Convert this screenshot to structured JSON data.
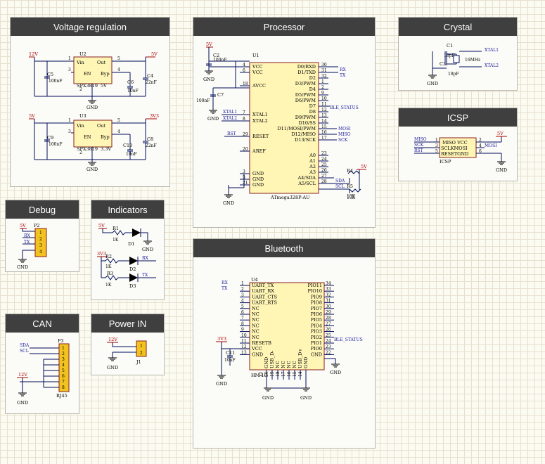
{
  "panels": {
    "voltage": "Voltage regulation",
    "processor": "Processor",
    "crystal": "Crystal",
    "icsp": "ICSP",
    "debug": "Debug",
    "indicators": "Indicators",
    "can": "CAN",
    "power": "Power IN",
    "bluetooth": "Bluetooth"
  },
  "labels": {
    "v12": "12V",
    "v5": "5V",
    "v3v3": "3V3",
    "gnd": "GND",
    "vin": "Vin",
    "out": "Out",
    "en": "EN",
    "byp": "Byp",
    "u2": "U2",
    "u3": "U3",
    "reg_part": "SPX3819",
    "reg_5v": "5V",
    "reg_3v3": "3.3V",
    "c5": "C5",
    "c6": "C6",
    "c4": "C4",
    "c9": "C9",
    "c10": "C10",
    "c8": "C8",
    "c2": "C2",
    "c7": "C7",
    "c11": "C11",
    "c1": "C1",
    "c3": "C3",
    "cap100nf": "100nF",
    "cap10nf": "10nF",
    "cap22nf": "22nF",
    "cap18pf": "18pF",
    "cap10uf": "10uF",
    "u1": "U1",
    "atmega": "ATmega328P-AU",
    "xtal1": "XTAL1",
    "xtal2": "XTAL2",
    "rst": "RST",
    "mosi": "MOSI",
    "miso": "MISO",
    "sck": "SCK",
    "rx": "RX",
    "tx": "TX",
    "ble_status": "BLE_STATUS",
    "sda": "SDA",
    "scl": "SCL",
    "r4": "R4",
    "r5": "R5",
    "r10k": "10K",
    "r1": "R1",
    "r2": "R2",
    "r3": "R3",
    "r1k": "1K",
    "d1": "D1",
    "d2": "D2",
    "d3": "D3",
    "freq": "16MHz",
    "icsp_ref": "ICSP",
    "misovcc": "MISO VCC",
    "sckmosi": "SCLKMOSI",
    "resetgnd": "RESETGND",
    "p2": "P2",
    "p3": "P3",
    "j1": "J1",
    "rj45": "RJ45",
    "u4": "U4",
    "hm10": "HM-10"
  },
  "atmega_left": [
    {
      "n": "4",
      "name": "VCC"
    },
    {
      "n": "6",
      "name": "VCC"
    },
    {
      "n": "18",
      "name": "AVCC"
    },
    {
      "n": "7",
      "name": "XTAL1"
    },
    {
      "n": "8",
      "name": "XTAL2"
    },
    {
      "n": "29",
      "name": "RESET"
    },
    {
      "n": "20",
      "name": "AREF"
    },
    {
      "n": "3",
      "name": "GND"
    },
    {
      "n": "5",
      "name": "GND"
    },
    {
      "n": "21",
      "name": "GND"
    }
  ],
  "atmega_right": [
    {
      "n": "30",
      "name": "D0/RXD"
    },
    {
      "n": "31",
      "name": "D1/TXD"
    },
    {
      "n": "32",
      "name": "D2"
    },
    {
      "n": "1",
      "name": "D3/PWM"
    },
    {
      "n": "2",
      "name": "D4"
    },
    {
      "n": "9",
      "name": "D5/PWM"
    },
    {
      "n": "10",
      "name": "D6/PWM"
    },
    {
      "n": "11",
      "name": "D7"
    },
    {
      "n": "12",
      "name": "D8"
    },
    {
      "n": "13",
      "name": "D9/PWM"
    },
    {
      "n": "14",
      "name": "D10/SS"
    },
    {
      "n": "15",
      "name": "D11/MOSI/PWM"
    },
    {
      "n": "16",
      "name": "D12/MISO"
    },
    {
      "n": "17",
      "name": "D13/SCK"
    },
    {
      "n": "23",
      "name": "A0"
    },
    {
      "n": "24",
      "name": "A1"
    },
    {
      "n": "25",
      "name": "A2"
    },
    {
      "n": "26",
      "name": "A3"
    },
    {
      "n": "27",
      "name": "A4/SDA"
    },
    {
      "n": "28",
      "name": "A5/SCL"
    }
  ],
  "hm10_left": [
    {
      "n": "1",
      "name": "UART_TX"
    },
    {
      "n": "2",
      "name": "UART_RX"
    },
    {
      "n": "3",
      "name": "UART_CTS"
    },
    {
      "n": "4",
      "name": "UART_RTS"
    },
    {
      "n": "5",
      "name": "NC"
    },
    {
      "n": "6",
      "name": "NC"
    },
    {
      "n": "7",
      "name": "NC"
    },
    {
      "n": "8",
      "name": "NC"
    },
    {
      "n": "9",
      "name": "NC"
    },
    {
      "n": "10",
      "name": "NC"
    },
    {
      "n": "11",
      "name": "RESETB"
    },
    {
      "n": "12",
      "name": "VCC"
    },
    {
      "n": "13",
      "name": "GND"
    }
  ],
  "hm10_right": [
    {
      "n": "34",
      "name": "PIO11"
    },
    {
      "n": "33",
      "name": "PIO10"
    },
    {
      "n": "32",
      "name": "PIO9"
    },
    {
      "n": "31",
      "name": "PIO8"
    },
    {
      "n": "30",
      "name": "PIO7"
    },
    {
      "n": "29",
      "name": "PIO6"
    },
    {
      "n": "28",
      "name": "PIO5"
    },
    {
      "n": "27",
      "name": "PIO4"
    },
    {
      "n": "26",
      "name": "PIO3"
    },
    {
      "n": "25",
      "name": "PIO2"
    },
    {
      "n": "24",
      "name": "PIO1"
    },
    {
      "n": "23",
      "name": "PIO0"
    },
    {
      "n": "22",
      "name": "GND"
    }
  ],
  "hm10_bottom": [
    "GND",
    "USB_D-",
    "NC",
    "NC",
    "NC",
    "NC",
    "USB_D+",
    "GND"
  ],
  "hm10_bottom_pins": [
    "21",
    "20",
    "19",
    "18",
    "17",
    "16",
    "15",
    "14"
  ],
  "icsp_pins": [
    "1",
    "3",
    "5",
    "2",
    "4",
    "6"
  ],
  "debug_pins": [
    "1",
    "2",
    "3",
    "4"
  ],
  "can_pins": [
    "1",
    "2",
    "3",
    "4",
    "5",
    "6",
    "7",
    "8"
  ],
  "power_pins": [
    "1",
    "2"
  ]
}
